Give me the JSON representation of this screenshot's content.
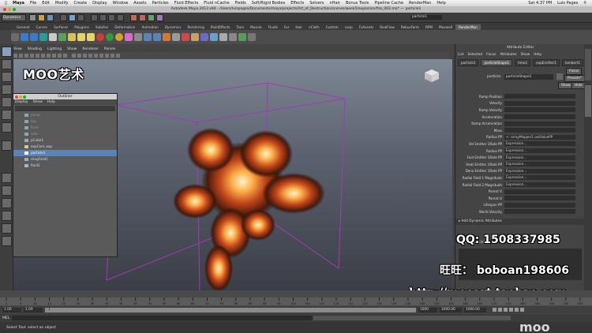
{
  "mac_menu": {
    "app": "Maya",
    "items": [
      "File",
      "Edit",
      "Modify",
      "Create",
      "Display",
      "Window",
      "Assets",
      "Particles",
      "Fluid Effects",
      "Fluid nCache",
      "Fields",
      "Soft/Rigid Bodies",
      "Effects",
      "Solvers",
      "nHair",
      "Bonus Tools",
      "Pipeline Cache",
      "RenderMan",
      "Help"
    ],
    "clock": "Sat 4:37 PM",
    "user": "Luis Pages"
  },
  "window_title": "Autodesk Maya 2013 x64 - /Users/luispages/Documents/maya/projects/Art_of_Destruction/scenes/week5/explosion/fire_002.ma* --- particle1",
  "status_line": {
    "mode": "Dynamics",
    "search_field": "particle1"
  },
  "shelf_tabs": [
    "General",
    "Curves",
    "Surfaces",
    "Polygons",
    "Subdivs",
    "Deformation",
    "Animation",
    "Dynamics",
    "Rendering",
    "PaintEffects",
    "Toon",
    "Muscle",
    "Fluids",
    "Fur",
    "Hair",
    "nCloth",
    "Custom",
    "coop",
    "FxAssets",
    "RealFlow",
    "RebusFarm",
    "RPM",
    "Maxwell",
    "RenderMan"
  ],
  "shelf_active": "RenderMan",
  "panel_menu": [
    "View",
    "Shading",
    "Lighting",
    "Show",
    "Renderer",
    "Panels"
  ],
  "watermark_logo": "MOO艺术",
  "outliner": {
    "title": "Outliner",
    "menu": [
      "Display",
      "Show",
      "Help"
    ],
    "items": [
      {
        "label": "persp",
        "state": "dim"
      },
      {
        "label": "top",
        "state": "dim"
      },
      {
        "label": "front",
        "state": "dim"
      },
      {
        "label": "side",
        "state": "dim"
      },
      {
        "label": "pCube1",
        "state": "normal"
      },
      {
        "label": "expCore_exp",
        "state": "normal"
      },
      {
        "label": "particle1",
        "state": "selected"
      },
      {
        "label": "dragField1",
        "state": "normal"
      },
      {
        "label": "fluid1",
        "state": "normal"
      }
    ]
  },
  "attribute_editor": {
    "title": "Attribute Editor",
    "menu": [
      "List",
      "Selected",
      "Focus",
      "Attributes",
      "Show",
      "Help"
    ],
    "tabs": [
      "particle1",
      "particleShape1",
      "time1",
      "expEmitter1",
      "lambert1"
    ],
    "active_tab": "particleShape1",
    "node_label": "particle:",
    "node_value": "particleShape1",
    "buttons": {
      "focus": "Focus",
      "presets": "Presets*",
      "show": "Show",
      "hide": "Hide"
    },
    "rows": [
      {
        "label": "Ramp Position",
        "value": ""
      },
      {
        "label": "Velocity",
        "value": ""
      },
      {
        "label": "Ramp Velocity",
        "value": ""
      },
      {
        "label": "Acceleration",
        "value": ""
      },
      {
        "label": "Ramp Acceleration",
        "value": ""
      },
      {
        "label": "Mass",
        "value": ""
      },
      {
        "label": "Radius PP",
        "value": "<- arrayMapper1.outValuePP"
      },
      {
        "label": "Vel Emitter 1Rate PP",
        "value": "Expression..."
      },
      {
        "label": "Radius PP",
        "value": "Expression..."
      },
      {
        "label": "Fuel Emitter 1Rate PP",
        "value": "Expression..."
      },
      {
        "label": "Heat Emitter 1Rate PP",
        "value": "Expression..."
      },
      {
        "label": "Dens Emitter 1Rate PP",
        "value": "Expression..."
      },
      {
        "label": "Radial Field 1 Magnitude",
        "value": "Expression..."
      },
      {
        "label": "Radial Field 2 Magnitude",
        "value": "Expression..."
      },
      {
        "label": "Parent V",
        "value": ""
      },
      {
        "label": "Parent U",
        "value": ""
      },
      {
        "label": "Lifespan PP",
        "value": ""
      },
      {
        "label": "World Velocity",
        "value": ""
      }
    ],
    "section": "Add Dynamic Attributes",
    "notes": "Notes: particleShape1"
  },
  "overlay": {
    "qq_label": "QQ:",
    "qq_value": "1508337985",
    "wangwang_label": "旺旺：",
    "wangwang_value": "boboan198606",
    "url": "http://mooart.taobao.com",
    "brand": "moo"
  },
  "timeline": {
    "ticks": [
      "1",
      "5",
      "10",
      "15",
      "20",
      "25",
      "30",
      "35",
      "40",
      "45",
      "50",
      "55",
      "60",
      "65",
      "70",
      "75",
      "80",
      "85",
      "90",
      "95",
      "100",
      "105",
      "110",
      "115",
      "120",
      "125",
      "130",
      "135",
      "140",
      "145",
      "150",
      "155",
      "160",
      "165",
      "170",
      "175",
      "180",
      "185",
      "190",
      "195",
      "200"
    ],
    "range_start": "1.00",
    "range_playback_start": "1.00",
    "range_marker": "1",
    "range_end": "1000",
    "range_playback_end": "1000.00",
    "range_max": "1000.00"
  },
  "command_line": {
    "label": "MEL"
  },
  "help_line": "Select Tool: select an object"
}
